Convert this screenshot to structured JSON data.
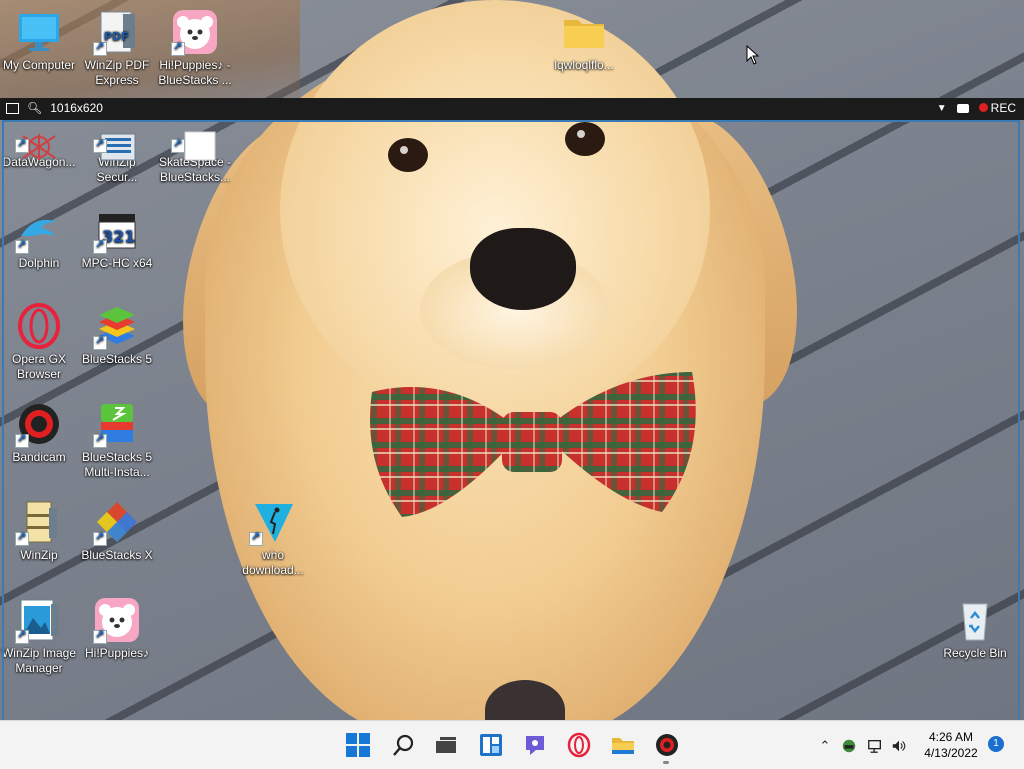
{
  "desktop": {
    "icons": [
      {
        "id": "my-computer",
        "label": "My Computer",
        "icon": "monitor-icon"
      },
      {
        "id": "winzip-pdf",
        "label": "WinZip PDF Express",
        "icon": "pdf-icon"
      },
      {
        "id": "hipuppies-bs",
        "label": "Hi!Puppies♪ - BlueStacks ...",
        "icon": "puppy-app-icon"
      },
      {
        "id": "folder",
        "label": "lqwloqlflo...",
        "icon": "folder-icon"
      },
      {
        "id": "datawagon",
        "label": "DataWagon...",
        "icon": "datawagon-icon"
      },
      {
        "id": "winzip-secure",
        "label": "WinZip Secur...",
        "icon": "winzip-secure-icon"
      },
      {
        "id": "skatespace",
        "label": "SkateSpace - BlueStacks...",
        "icon": "blank-app-icon"
      },
      {
        "id": "dolphin",
        "label": "Dolphin",
        "icon": "dolphin-icon"
      },
      {
        "id": "mpc-hc",
        "label": "MPC-HC x64",
        "icon": "mpc-icon"
      },
      {
        "id": "opera-gx",
        "label": "Opera GX Browser",
        "icon": "opera-icon"
      },
      {
        "id": "bluestacks5",
        "label": "BlueStacks 5",
        "icon": "bluestacks-icon"
      },
      {
        "id": "bandicam",
        "label": "Bandicam",
        "icon": "bandicam-icon"
      },
      {
        "id": "bluestacks-multi",
        "label": "BlueStacks 5 Multi-Insta...",
        "icon": "bluestacks-multi-icon"
      },
      {
        "id": "winzip",
        "label": "WinZip",
        "icon": "winzip-icon"
      },
      {
        "id": "bluestacks-x",
        "label": "BlueStacks X",
        "icon": "bluestacks-x-icon"
      },
      {
        "id": "who-download",
        "label": "who download...",
        "icon": "who-icon"
      },
      {
        "id": "winzip-image",
        "label": "WinZip Image Manager",
        "icon": "winzip-image-icon"
      },
      {
        "id": "hipuppies",
        "label": "Hi!Puppies♪",
        "icon": "puppy-app-icon"
      },
      {
        "id": "recycle-bin",
        "label": "Recycle Bin",
        "icon": "recycle-bin-icon"
      }
    ]
  },
  "capture_bar": {
    "resolution": "1016x620",
    "rec_label": "REC"
  },
  "taskbar": {
    "items": [
      "start-icon",
      "search-icon",
      "task-view-icon",
      "widgets-icon",
      "chat-icon",
      "opera-icon",
      "file-explorer-icon",
      "bandicam-icon"
    ],
    "clock_time": "4:26 AM",
    "clock_date": "4/13/2022",
    "notification_count": "1"
  },
  "colors": {
    "capture_frame": "#3a7bb5",
    "taskbar_bg": "#f3f3f3",
    "rec_red": "#e02020"
  }
}
